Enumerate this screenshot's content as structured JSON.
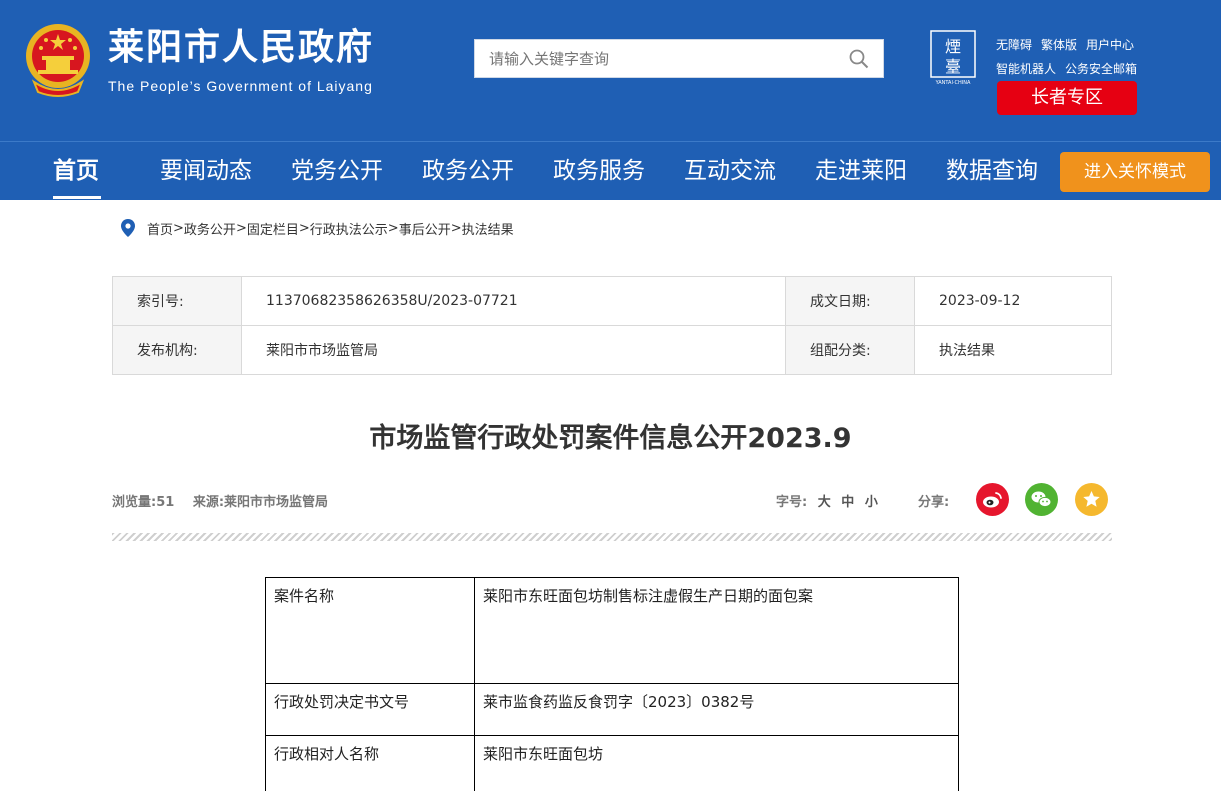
{
  "header": {
    "title": "莱阳市人民政府",
    "subtitle": "The People’s Government of Laiyang",
    "search_placeholder": "请输入关键字查询",
    "links_row1": [
      "无障碍",
      "繁体版",
      "用户中心"
    ],
    "links_row2": [
      "智能机器人",
      "公务安全邮箱"
    ],
    "elder_zone": "长者专区"
  },
  "nav": {
    "items": [
      "首页",
      "要闻动态",
      "党务公开",
      "政务公开",
      "政务服务",
      "互动交流",
      "走进莱阳",
      "数据查询"
    ],
    "care_mode": "进入关怀模式"
  },
  "breadcrumb": [
    "首页",
    "政务公开",
    "固定栏目",
    "行政执法公示",
    "事后公开",
    "执法结果"
  ],
  "meta": {
    "index_label": "索引号:",
    "index_value": "11370682358626358U/2023-07721",
    "date_label": "成文日期:",
    "date_value": "2023-09-12",
    "publisher_label": "发布机构:",
    "publisher_value": "莱阳市市场监管局",
    "category_label": "组配分类:",
    "category_value": "执法结果"
  },
  "article": {
    "title": "市场监管行政处罚案件信息公开2023.9",
    "views": "浏览量:51",
    "source": "来源:莱阳市市场监管局",
    "font_label": "字号:",
    "font_options": [
      "大",
      "中",
      "小"
    ],
    "share_label": "分享:"
  },
  "case_table": [
    {
      "label": "案件名称",
      "value": "莱阳市东旺面包坊制售标注虚假生产日期的面包案"
    },
    {
      "label": "行政处罚决定书文号",
      "value": "莱市监食药监反食罚字〔2023〕0382号"
    },
    {
      "label": "行政相对人名称",
      "value": "莱阳市东旺面包坊"
    }
  ],
  "colors": {
    "header_blue": "#1f5fb4",
    "elder_red": "#e60012",
    "care_orange": "#f0921c",
    "weibo": "#e6162d",
    "wechat": "#51b332",
    "favorite": "#f5b82e"
  },
  "icons": [
    "national-emblem-icon",
    "search-icon",
    "yantai-logo-icon",
    "location-pin-icon",
    "weibo-icon",
    "wechat-icon",
    "favorite-icon"
  ]
}
